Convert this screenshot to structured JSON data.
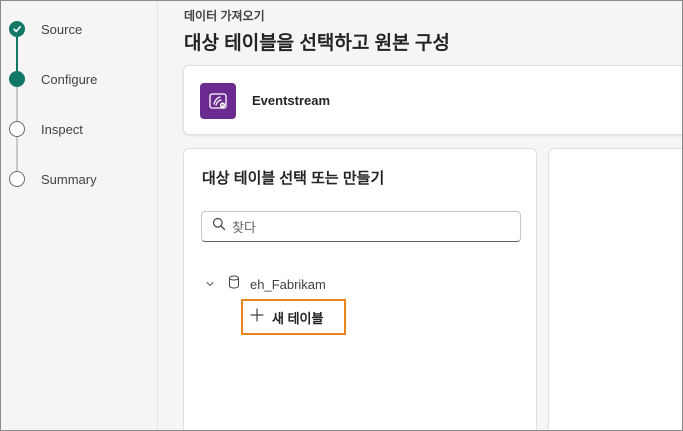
{
  "steps": [
    {
      "label": "Source",
      "state": "done"
    },
    {
      "label": "Configure",
      "state": "current"
    },
    {
      "label": "Inspect",
      "state": "pending"
    },
    {
      "label": "Summary",
      "state": "pending"
    }
  ],
  "header": {
    "breadcrumb": "데이터 가져오기",
    "title": "대상 테이블을 선택하고 원본 구성"
  },
  "source": {
    "name": "Eventstream",
    "icon": "eventstream-icon"
  },
  "destination": {
    "title": "대상 테이블 선택 또는 만들기",
    "search_placeholder": "찾다",
    "database": "eh_Fabrikam",
    "new_table_label": "새 테이블"
  },
  "colors": {
    "accent": "#117865",
    "highlight": "#e8861a",
    "eventstream": "#6b2a8f"
  }
}
